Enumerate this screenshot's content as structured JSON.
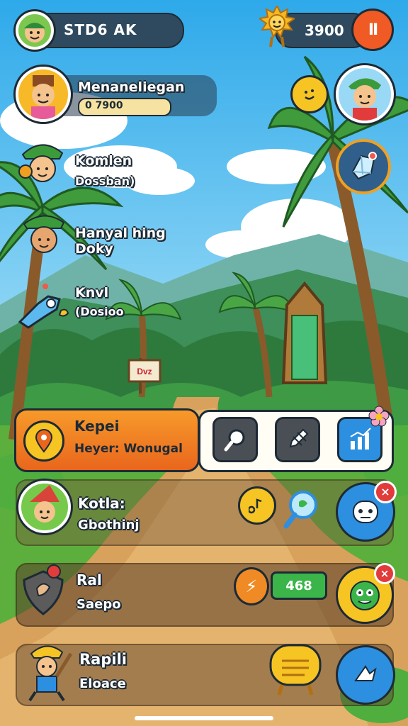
{
  "hud": {
    "player_name": "STD6 AK",
    "coins": "3900",
    "pause_label": "II"
  },
  "profile": {
    "name": "Menaneliegan",
    "amount": "0 7900"
  },
  "characters": [
    {
      "name": "Komlen",
      "sub": "Dossban)"
    },
    {
      "name": "Hanyal hing Doky",
      "sub": ""
    },
    {
      "name": "Knvl",
      "sub": "(Dosioo"
    }
  ],
  "quest": {
    "title": "Kepei",
    "subtitle": "Heyer: Wonugal"
  },
  "list": [
    {
      "title": "Kotla:",
      "sub": "Gbothinj"
    },
    {
      "title": "Ral",
      "sub": "Saepo",
      "badge": "468"
    },
    {
      "title": "Rapili",
      "sub": "Eloace"
    }
  ],
  "sign_text": "Dvz",
  "colors": {
    "sky": "#3fb6ec",
    "hud_bar": "#2f4a5e",
    "orange": "#f07a22",
    "green": "#3bb54a",
    "yellow": "#f6c423",
    "blue": "#2d8fe0"
  }
}
